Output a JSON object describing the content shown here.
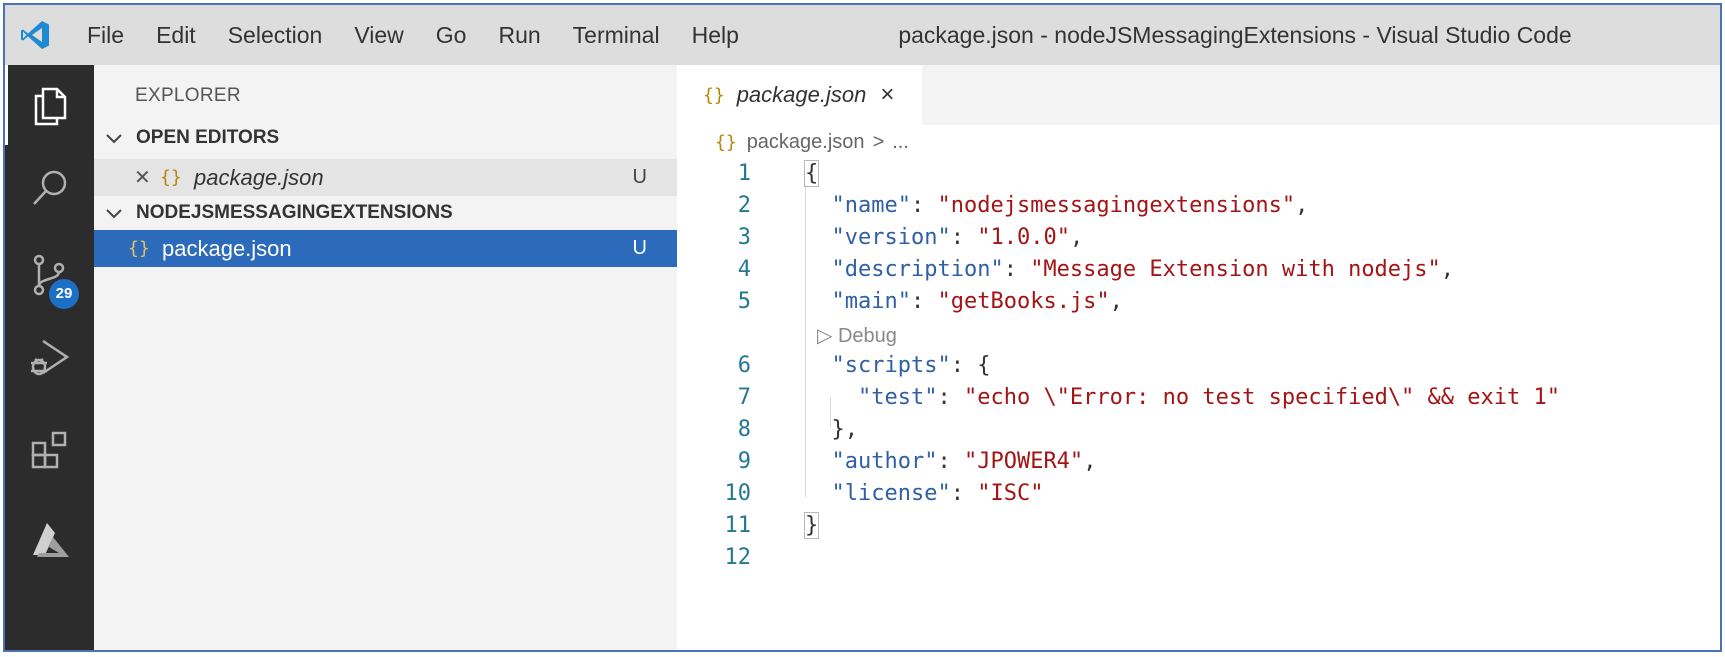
{
  "window": {
    "title": "package.json - nodeJSMessagingExtensions - Visual Studio Code",
    "menu": [
      "File",
      "Edit",
      "Selection",
      "View",
      "Go",
      "Run",
      "Terminal",
      "Help"
    ]
  },
  "activity_bar": {
    "items": [
      {
        "icon": "explorer-icon",
        "active": true
      },
      {
        "icon": "search-icon"
      },
      {
        "icon": "source-control-icon",
        "badge": "29"
      },
      {
        "icon": "run-debug-icon"
      },
      {
        "icon": "extensions-icon"
      },
      {
        "icon": "azure-icon"
      }
    ],
    "scm_badge": "29"
  },
  "sidebar": {
    "title": "EXPLORER",
    "open_editors": {
      "header": "OPEN EDITORS",
      "file": {
        "icon": "{}",
        "name": "package.json",
        "status": "U"
      }
    },
    "folder": {
      "header": "NODEJSMESSAGINGEXTENSIONS",
      "file": {
        "icon": "{}",
        "name": "package.json",
        "status": "U"
      }
    }
  },
  "editor": {
    "tab": {
      "icon": "{}",
      "name": "package.json",
      "close": "×"
    },
    "breadcrumb": {
      "icon": "{}",
      "file": "package.json",
      "sep": ">",
      "more": "..."
    },
    "codelens": "▷ Debug",
    "lines": [
      {
        "n": "1",
        "text": "{"
      },
      {
        "n": "2",
        "key": "\"name\"",
        "value": "\"nodejsmessagingextensions\"",
        "tail": ","
      },
      {
        "n": "3",
        "key": "\"version\"",
        "value": "\"1.0.0\"",
        "tail": ","
      },
      {
        "n": "4",
        "key": "\"description\"",
        "value": "\"Message Extension with nodejs\"",
        "tail": ","
      },
      {
        "n": "5",
        "key": "\"main\"",
        "value": "\"getBooks.js\"",
        "tail": ","
      },
      {
        "n": "6",
        "key": "\"scripts\"",
        "value": "{",
        "tail": ""
      },
      {
        "n": "7",
        "key": "\"test\"",
        "value": "\"echo \\\"Error: no test specified\\\" && exit 1\"",
        "tail": ""
      },
      {
        "n": "8",
        "text": "},"
      },
      {
        "n": "9",
        "key": "\"author\"",
        "value": "\"JPOWER4\"",
        "tail": ","
      },
      {
        "n": "10",
        "key": "\"license\"",
        "value": "\"ISC\"",
        "tail": ""
      },
      {
        "n": "11",
        "text": "}"
      },
      {
        "n": "12",
        "text": ""
      }
    ]
  },
  "colors": {
    "activity_bar": "#2c2c2c",
    "sidebar": "#f3f3f3",
    "selection": "#2c6bbb",
    "json_key": "#2f5fa5",
    "json_string": "#a31515",
    "line_number": "#237893"
  }
}
